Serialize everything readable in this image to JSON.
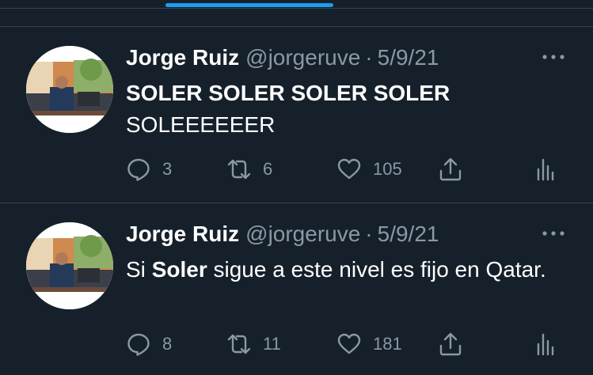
{
  "tweets": [
    {
      "name": "Jorge Ruiz",
      "handle": "@jorgeruve",
      "separator": "·",
      "date": "5/9/21",
      "lines": [
        "SOLER SOLER SOLER SOLER",
        "SOLEEEEEER"
      ],
      "replies": "3",
      "retweets": "6",
      "likes": "105"
    },
    {
      "name": "Jorge Ruiz",
      "handle": "@jorgeruve",
      "separator": "·",
      "date": "5/9/21",
      "text_prefix": "Si ",
      "text_bold": "Soler",
      "text_suffix": " sigue a este nivel es fijo en Qatar.",
      "replies": "8",
      "retweets": "11",
      "likes": "181"
    }
  ],
  "icons": {
    "reply": "reply-icon",
    "retweet": "retweet-icon",
    "like": "like-icon",
    "share": "share-icon",
    "analytics": "analytics-icon",
    "more": "more-icon"
  },
  "colors": {
    "background": "#15202b",
    "secondary_text": "#8b98a5",
    "accent": "#1d9bf0",
    "divider": "#38444d"
  }
}
